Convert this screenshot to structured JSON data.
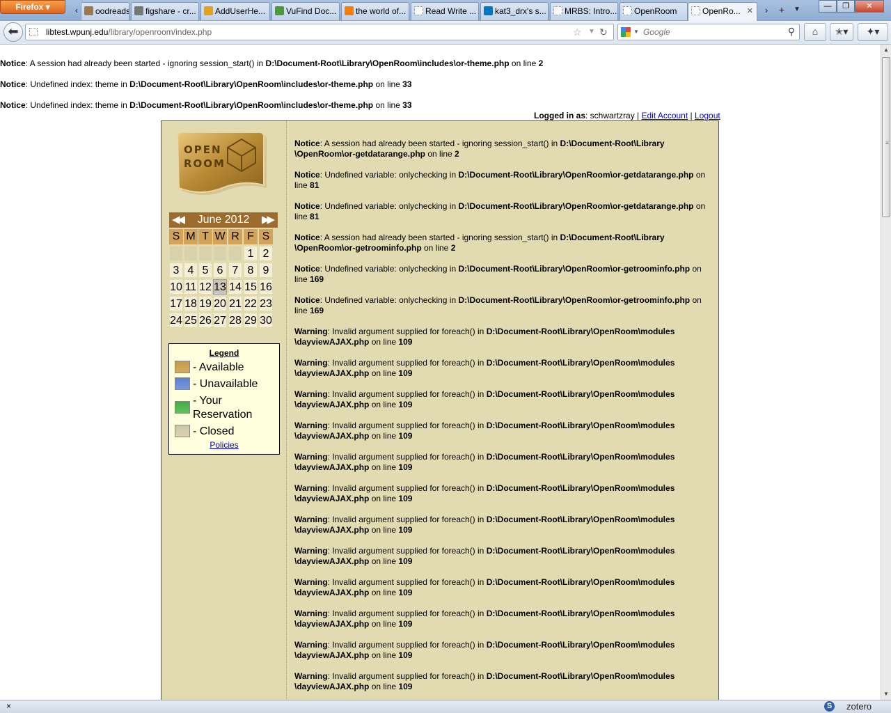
{
  "browser": {
    "app_button": "Firefox",
    "tabs": [
      {
        "label": "oodreads |...",
        "icon": "goodreads-icon",
        "color": "#9a7b4f"
      },
      {
        "label": "figshare - cr...",
        "icon": "figshare-icon",
        "color": "#777777"
      },
      {
        "label": "AddUserHe...",
        "icon": "chrome-icon",
        "color": "#e3a21a"
      },
      {
        "label": "VuFind Doc...",
        "icon": "vufind-icon",
        "color": "#4a9a3a"
      },
      {
        "label": "the world of...",
        "icon": "blogger-icon",
        "color": "#f57d00"
      },
      {
        "label": "Read Write ...",
        "icon": "blank-page-icon",
        "color": "#ffffff"
      },
      {
        "label": "kat3_drx's s...",
        "icon": "drupal-icon",
        "color": "#0077c0"
      },
      {
        "label": "MRBS: Intro...",
        "icon": "blank-page-icon",
        "color": "#ffffff"
      },
      {
        "label": "OpenRoom",
        "icon": "blank-page-icon",
        "color": "#ffffff"
      },
      {
        "label": "OpenRo...",
        "icon": "blank-page-icon",
        "color": "#ffffff",
        "active": true
      }
    ],
    "url_host": "libtest.wpunj.edu",
    "url_path": "/library/openroom/index.php",
    "search_placeholder": "Google",
    "status_close": "×",
    "zotero_letter": "S",
    "zotero_label": "zotero"
  },
  "top_notices": [
    {
      "level": "Notice",
      "text": ": A session had already been started - ignoring session_start() in ",
      "file": "D:\\Document-Root\\Library\\OpenRoom\\includes\\or-theme.php",
      "online": " on line ",
      "line": "2"
    },
    {
      "level": "Notice",
      "text": ": Undefined index: theme in ",
      "file": "D:\\Document-Root\\Library\\OpenRoom\\includes\\or-theme.php",
      "online": " on line ",
      "line": "33"
    },
    {
      "level": "Notice",
      "text": ": Undefined index: theme in ",
      "file": "D:\\Document-Root\\Library\\OpenRoom\\includes\\or-theme.php",
      "online": " on line ",
      "line": "33"
    }
  ],
  "login": {
    "label": "Logged in as",
    "user": ": schwartzray | ",
    "edit": "Edit Account",
    "sep": " | ",
    "logout": "Logout"
  },
  "logo": {
    "line1": "OPEN",
    "line2": "ROOM"
  },
  "calendar": {
    "month": "June 2012",
    "prev": "◀◀",
    "next": "▶▶",
    "dow": [
      "S",
      "M",
      "T",
      "W",
      "R",
      "F",
      "S"
    ],
    "weeks": [
      [
        "",
        "",
        "",
        "",
        "",
        "1",
        "2"
      ],
      [
        "3",
        "4",
        "5",
        "6",
        "7",
        "8",
        "9"
      ],
      [
        "10",
        "11",
        "12",
        "13",
        "14",
        "15",
        "16"
      ],
      [
        "17",
        "18",
        "19",
        "20",
        "21",
        "22",
        "23"
      ],
      [
        "24",
        "25",
        "26",
        "27",
        "28",
        "29",
        "30"
      ]
    ],
    "today": "13"
  },
  "legend": {
    "title": "Legend",
    "items": [
      {
        "label": "- Available",
        "color": "#c69a46"
      },
      {
        "label": "- Unavailable",
        "color": "#5a7fd6"
      },
      {
        "label": "- Your",
        "label2": "Reservation",
        "color": "#3fae3f"
      },
      {
        "label": "- Closed",
        "color": "#cfc7a8"
      }
    ],
    "policies": "Policies"
  },
  "messages": [
    {
      "level": "Notice",
      "a": ": A session had already been started - ignoring session_start() in ",
      "file1": "D:\\Document-Root\\Library",
      "file2": "\\OpenRoom\\or-getdatarange.php",
      "online": " on line ",
      "line": "2"
    },
    {
      "level": "Notice",
      "a": ": Undefined variable: onlychecking in ",
      "file1": "D:\\Document-Root\\Library\\OpenRoom\\or-getdatarange.php",
      "file2": "",
      "online": " on line ",
      "line": "81"
    },
    {
      "level": "Notice",
      "a": ": Undefined variable: onlychecking in ",
      "file1": "D:\\Document-Root\\Library\\OpenRoom\\or-getdatarange.php",
      "file2": "",
      "online": " on line ",
      "line": "81"
    },
    {
      "level": "Notice",
      "a": ": A session had already been started - ignoring session_start() in ",
      "file1": "D:\\Document-Root\\Library",
      "file2": "\\OpenRoom\\or-getroominfo.php",
      "online": " on line ",
      "line": "2"
    },
    {
      "level": "Notice",
      "a": ": Undefined variable: onlychecking in ",
      "file1": "D:\\Document-Root\\Library\\OpenRoom\\or-getroominfo.php",
      "file2": "",
      "online": " on line ",
      "line": "169"
    },
    {
      "level": "Notice",
      "a": ": Undefined variable: onlychecking in ",
      "file1": "D:\\Document-Root\\Library\\OpenRoom\\or-getroominfo.php",
      "file2": "",
      "online": " on line ",
      "line": "169"
    },
    {
      "level": "Warning",
      "a": ": Invalid argument supplied for foreach() in ",
      "file1": "D:\\Document-Root\\Library\\OpenRoom\\modules",
      "file2": "\\dayviewAJAX.php",
      "online": " on line ",
      "line": "109"
    },
    {
      "level": "Warning",
      "a": ": Invalid argument supplied for foreach() in ",
      "file1": "D:\\Document-Root\\Library\\OpenRoom\\modules",
      "file2": "\\dayviewAJAX.php",
      "online": " on line ",
      "line": "109"
    },
    {
      "level": "Warning",
      "a": ": Invalid argument supplied for foreach() in ",
      "file1": "D:\\Document-Root\\Library\\OpenRoom\\modules",
      "file2": "\\dayviewAJAX.php",
      "online": " on line ",
      "line": "109"
    },
    {
      "level": "Warning",
      "a": ": Invalid argument supplied for foreach() in ",
      "file1": "D:\\Document-Root\\Library\\OpenRoom\\modules",
      "file2": "\\dayviewAJAX.php",
      "online": " on line ",
      "line": "109"
    },
    {
      "level": "Warning",
      "a": ": Invalid argument supplied for foreach() in ",
      "file1": "D:\\Document-Root\\Library\\OpenRoom\\modules",
      "file2": "\\dayviewAJAX.php",
      "online": " on line ",
      "line": "109"
    },
    {
      "level": "Warning",
      "a": ": Invalid argument supplied for foreach() in ",
      "file1": "D:\\Document-Root\\Library\\OpenRoom\\modules",
      "file2": "\\dayviewAJAX.php",
      "online": " on line ",
      "line": "109"
    },
    {
      "level": "Warning",
      "a": ": Invalid argument supplied for foreach() in ",
      "file1": "D:\\Document-Root\\Library\\OpenRoom\\modules",
      "file2": "\\dayviewAJAX.php",
      "online": " on line ",
      "line": "109"
    },
    {
      "level": "Warning",
      "a": ": Invalid argument supplied for foreach() in ",
      "file1": "D:\\Document-Root\\Library\\OpenRoom\\modules",
      "file2": "\\dayviewAJAX.php",
      "online": " on line ",
      "line": "109"
    },
    {
      "level": "Warning",
      "a": ": Invalid argument supplied for foreach() in ",
      "file1": "D:\\Document-Root\\Library\\OpenRoom\\modules",
      "file2": "\\dayviewAJAX.php",
      "online": " on line ",
      "line": "109"
    },
    {
      "level": "Warning",
      "a": ": Invalid argument supplied for foreach() in ",
      "file1": "D:\\Document-Root\\Library\\OpenRoom\\modules",
      "file2": "\\dayviewAJAX.php",
      "online": " on line ",
      "line": "109"
    },
    {
      "level": "Warning",
      "a": ": Invalid argument supplied for foreach() in ",
      "file1": "D:\\Document-Root\\Library\\OpenRoom\\modules",
      "file2": "\\dayviewAJAX.php",
      "online": " on line ",
      "line": "109"
    },
    {
      "level": "Warning",
      "a": ": Invalid argument supplied for foreach() in ",
      "file1": "D:\\Document-Root\\Library\\OpenRoom\\modules",
      "file2": "\\dayviewAJAX.php",
      "online": " on line ",
      "line": "109"
    }
  ]
}
